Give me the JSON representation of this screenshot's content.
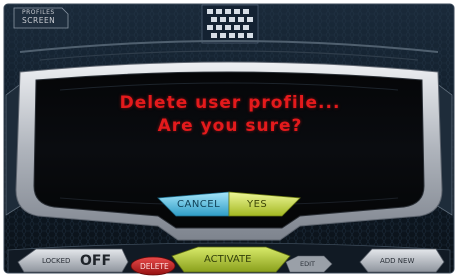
{
  "header": {
    "line1": "PROFILES",
    "line2": "SCREEN"
  },
  "dialog": {
    "line1": "Delete user profile...",
    "line2": "Are you sure?"
  },
  "dialog_buttons": {
    "cancel": "CANCEL",
    "yes": "YES"
  },
  "bottom_bar": {
    "toggle_label": "LOCKED",
    "toggle_value": "OFF",
    "delete": "DELETE",
    "activate": "ACTIVATE",
    "edit": "EDIT",
    "add_new": "ADD NEW"
  },
  "colors": {
    "alert_text": "#e41a1c",
    "cancel_button": "#5ec6e8",
    "yes_button": "#cde04a",
    "delete_button": "#c61a1a",
    "activate_button": "#b8d13a",
    "frame": "#c9ccd2",
    "background": "#0c1622"
  }
}
